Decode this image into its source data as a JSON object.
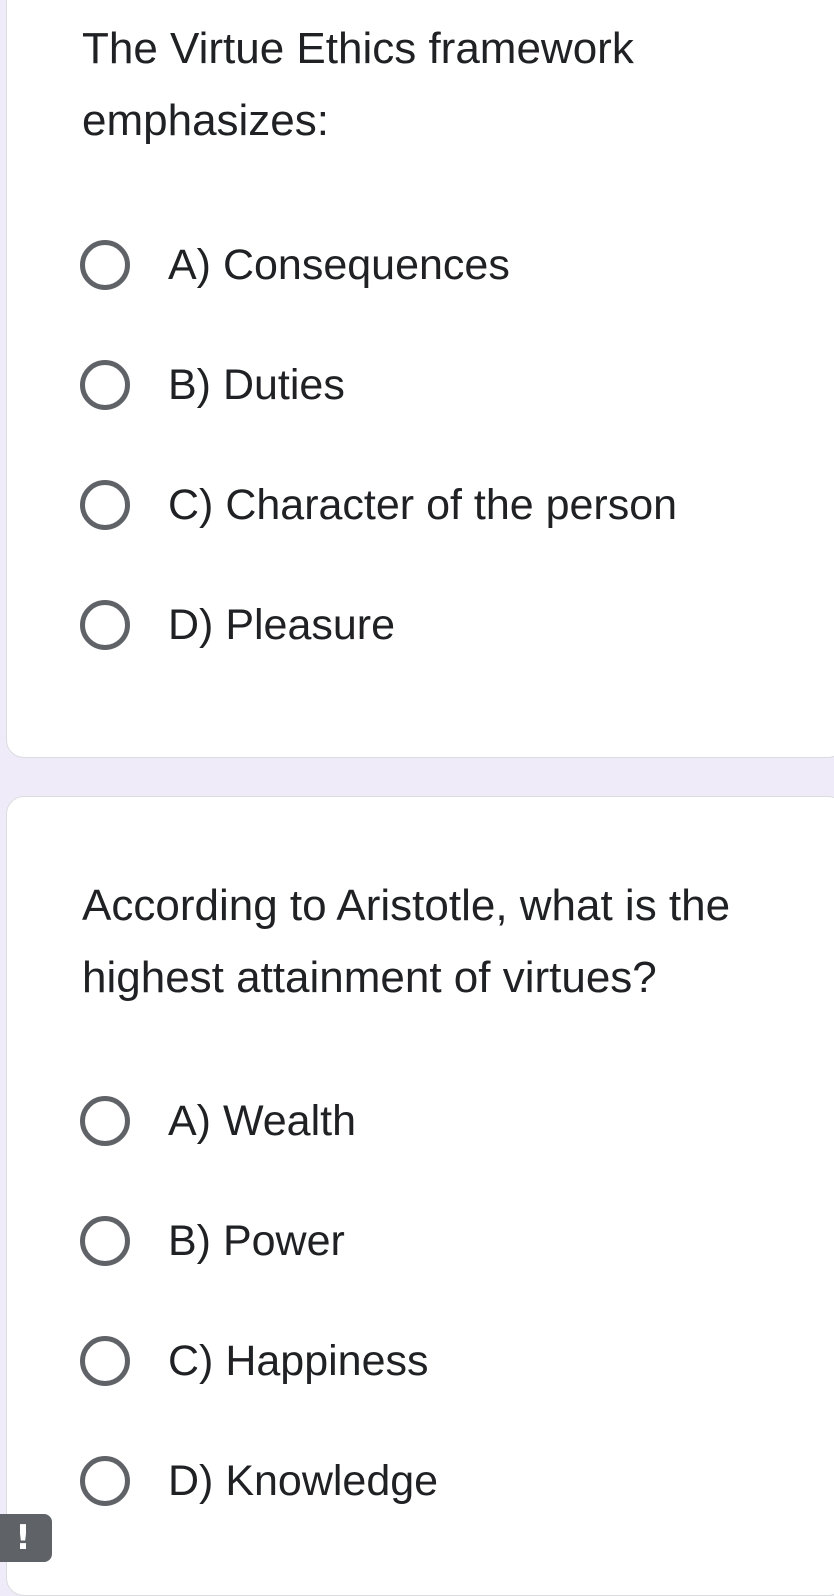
{
  "questions": [
    {
      "text": "The Virtue Ethics framework emphasizes:",
      "options": [
        {
          "label": "A) Consequences",
          "selected": false
        },
        {
          "label": "B) Duties",
          "selected": false
        },
        {
          "label": "C) Character of the person",
          "selected": false
        },
        {
          "label": "D) Pleasure",
          "selected": false
        }
      ]
    },
    {
      "text": "According to Aristotle, what is the highest attainment of virtues?",
      "options": [
        {
          "label": "A) Wealth",
          "selected": false
        },
        {
          "label": "B) Power",
          "selected": false
        },
        {
          "label": "C) Happiness",
          "selected": false
        },
        {
          "label": "D) Knowledge",
          "selected": false
        }
      ]
    }
  ],
  "alert_badge": {
    "icon": "exclamation-icon",
    "glyph": "!"
  },
  "colors": {
    "page_background": "#f0ebf8",
    "card_background": "#ffffff",
    "card_border": "#dadce0",
    "radio_outline": "#5f6368",
    "text": "#202124"
  }
}
